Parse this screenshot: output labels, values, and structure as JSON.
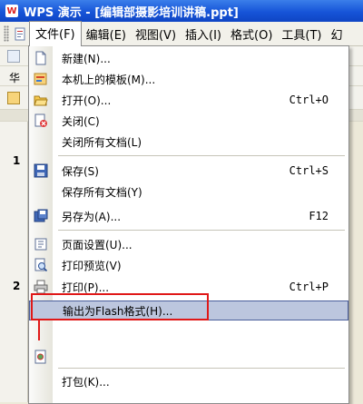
{
  "window": {
    "title": "WPS 演示 - [编辑部摄影培训讲稿.ppt]"
  },
  "menubar": {
    "items": [
      {
        "label": "文件(F)",
        "active": true
      },
      {
        "label": "编辑(E)"
      },
      {
        "label": "视图(V)"
      },
      {
        "label": "插入(I)"
      },
      {
        "label": "格式(O)"
      },
      {
        "label": "工具(T)"
      },
      {
        "label": "幻"
      }
    ]
  },
  "left_pane": {
    "font_label": "华",
    "slide_numbers": [
      "1",
      "2"
    ]
  },
  "file_menu": {
    "items": [
      {
        "label": "新建(N)...",
        "shortcut": "",
        "icon": "new-doc-icon"
      },
      {
        "label": "本机上的模板(M)...",
        "shortcut": "",
        "icon": "template-icon"
      },
      {
        "label": "打开(O)...",
        "shortcut": "Ctrl+O",
        "icon": "open-folder-icon"
      },
      {
        "label": "关闭(C)",
        "shortcut": "",
        "icon": "close-doc-icon"
      },
      {
        "label": "关闭所有文档(L)",
        "shortcut": "",
        "icon": ""
      },
      {
        "label": "保存(S)",
        "shortcut": "Ctrl+S",
        "icon": "save-icon"
      },
      {
        "label": "保存所有文档(Y)",
        "shortcut": "",
        "icon": ""
      },
      {
        "label": "另存为(A)...",
        "shortcut": "F12",
        "icon": "save-as-icon"
      },
      {
        "label": "页面设置(U)...",
        "shortcut": "",
        "icon": "page-setup-icon"
      },
      {
        "label": "打印预览(V)",
        "shortcut": "",
        "icon": "print-preview-icon"
      },
      {
        "label": "打印(P)...",
        "shortcut": "Ctrl+P",
        "icon": "print-icon"
      },
      {
        "label": "输出为Flash格式(H)...",
        "shortcut": "",
        "icon": "",
        "highlighted": true
      },
      {
        "label": "打包(K)...",
        "shortcut": "",
        "icon": ""
      }
    ]
  },
  "colors": {
    "title_bar": "#1654d8",
    "highlight": "#bcc6de",
    "annotation": "#e01818"
  }
}
